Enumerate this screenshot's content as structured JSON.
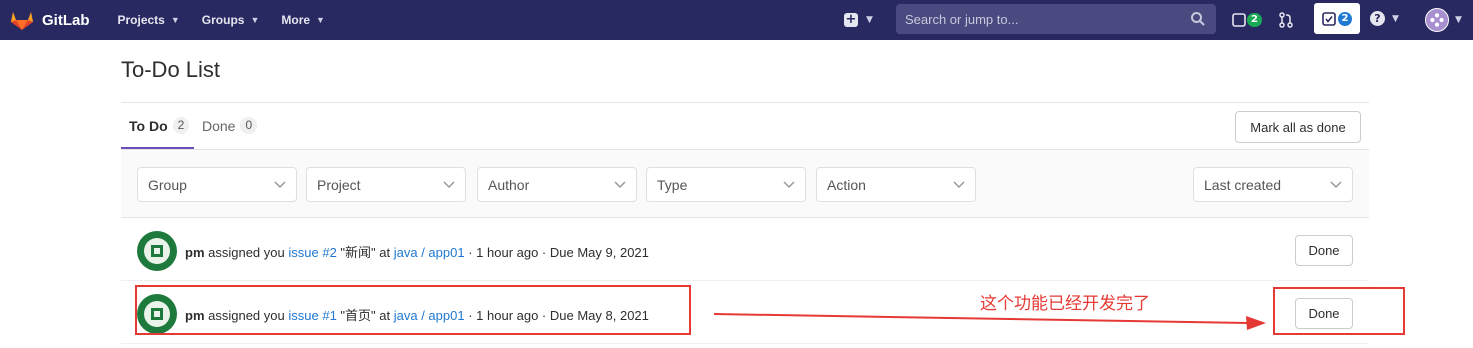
{
  "navbar": {
    "brand": "GitLab",
    "menu": [
      {
        "label": "Projects"
      },
      {
        "label": "Groups"
      },
      {
        "label": "More"
      }
    ],
    "search_placeholder": "Search or jump to...",
    "issues_count": "2",
    "todos_count": "2",
    "colors": {
      "bar": "#292961",
      "accent": "#1f78d1",
      "badge": "#1aaa55"
    }
  },
  "page": {
    "title": "To-Do List",
    "tabs": [
      {
        "label": "To Do",
        "count": "2",
        "active": true
      },
      {
        "label": "Done",
        "count": "0",
        "active": false
      }
    ],
    "mark_all_label": "Mark all as done"
  },
  "filters": {
    "dropdowns": [
      "Group",
      "Project",
      "Author",
      "Type",
      "Action"
    ],
    "sort": "Last created"
  },
  "todos": [
    {
      "author": "pm",
      "action": "assigned you",
      "target": "issue #2",
      "title": "\"新闻\"",
      "at": "at",
      "project": "java / app01",
      "time": "· 1 hour ago · Due May 9, 2021",
      "button": "Done"
    },
    {
      "author": "pm",
      "action": "assigned you",
      "target": "issue #1",
      "title": "\"首页\"",
      "at": "at",
      "project": "java / app01",
      "time": "· 1 hour ago · Due May 8, 2021",
      "button": "Done"
    }
  ],
  "annotation": {
    "text": "这个功能已经开发完了",
    "color": "#e53935"
  }
}
